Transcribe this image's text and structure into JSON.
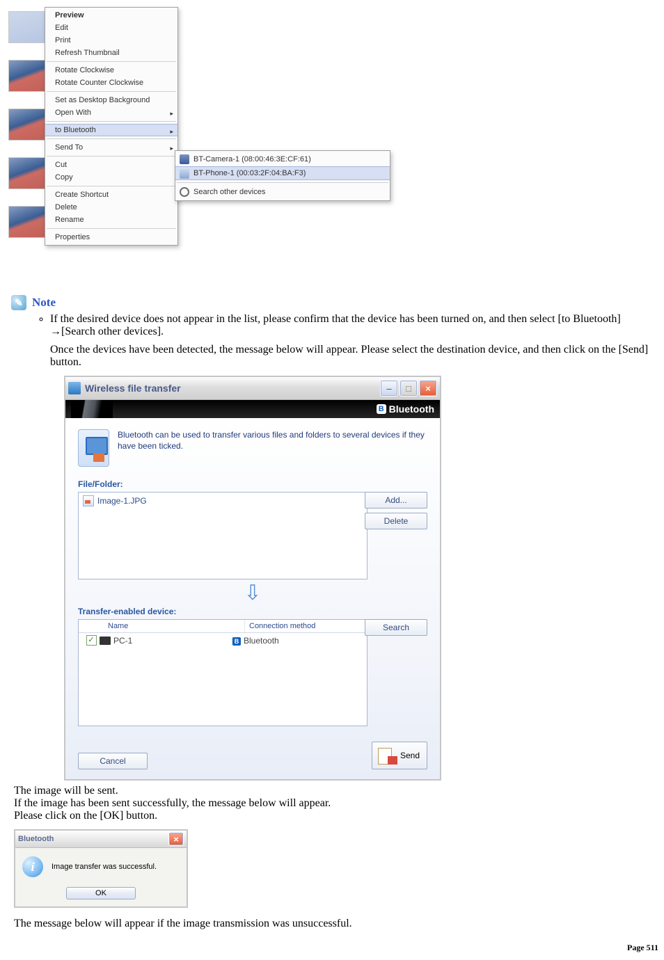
{
  "context_menu": {
    "items_top": [
      {
        "label": "Preview",
        "bold": true
      },
      {
        "label": "Edit"
      },
      {
        "label": "Print"
      },
      {
        "label": "Refresh Thumbnail"
      }
    ],
    "items_rotate": [
      {
        "label": "Rotate Clockwise"
      },
      {
        "label": "Rotate Counter Clockwise"
      }
    ],
    "items_desktop": [
      {
        "label": "Set as Desktop Background"
      },
      {
        "label": "Open With",
        "arrow": true
      }
    ],
    "bluetooth": {
      "label": "to Bluetooth",
      "arrow": true
    },
    "sendto": {
      "label": "Send To",
      "arrow": true
    },
    "items_edit": [
      {
        "label": "Cut"
      },
      {
        "label": "Copy"
      }
    ],
    "items_file": [
      {
        "label": "Create Shortcut"
      },
      {
        "label": "Delete"
      },
      {
        "label": "Rename"
      }
    ],
    "properties": {
      "label": "Properties"
    },
    "submenu": [
      {
        "label": "BT-Camera-1 (08:00:46:3E:CF:61)",
        "icon": "camera"
      },
      {
        "label": "BT-Phone-1 (00:03:2F:04:BA:F3)",
        "icon": "phone",
        "hi": true
      },
      {
        "label": "Search other devices",
        "icon": "search"
      }
    ]
  },
  "note": {
    "heading": "Note",
    "bullet": "If the desired device does not appear in the list, please confirm that the device has been turned on, and then select [to Bluetooth] →[Search other devices].",
    "para": "Once the devices have been detected, the message below will appear. Please select the destination device, and then click on the [Send] button."
  },
  "transfer_window": {
    "title": "Wireless file transfer",
    "brand": "Bluetooth",
    "intro_text": "Bluetooth can be used to transfer various files and folders to several devices if they have been ticked.",
    "file_section_label": "File/Folder:",
    "files": [
      {
        "name": "Image-1.JPG"
      }
    ],
    "device_section_label": "Transfer-enabled device:",
    "col_name": "Name",
    "col_conn": "Connection method",
    "devices": [
      {
        "checked": true,
        "name": "PC-1",
        "method": "Bluetooth"
      }
    ],
    "add_label": "Add...",
    "delete_label": "Delete",
    "search_label": "Search",
    "cancel_label": "Cancel",
    "send_label": "Send"
  },
  "after_window": {
    "line1": "The image will be sent.",
    "line2": "If the image has been sent successfully, the message below will appear.",
    "line3": "Please click on the [OK] button."
  },
  "msgbox": {
    "title": "Bluetooth",
    "message": "Image transfer was successful.",
    "ok": "OK"
  },
  "closing": "The message below will appear if the image transmission was unsuccessful.",
  "footer": "Page 511"
}
